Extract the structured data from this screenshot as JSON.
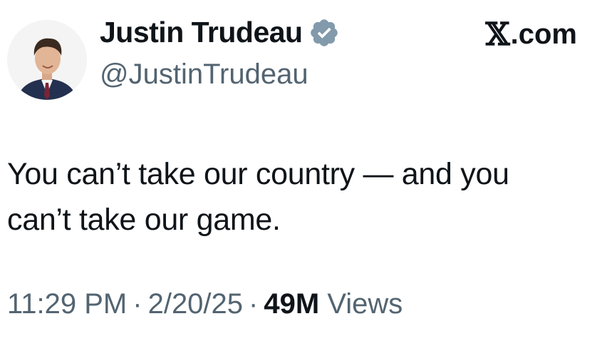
{
  "author": {
    "display_name": "Justin Trudeau",
    "handle": "@JustinTrudeau",
    "verified_icon": "verified-badge-icon",
    "avatar_icon": "profile-photo"
  },
  "brand": {
    "label": ".com",
    "logo_glyph": "𝕏"
  },
  "tweet": {
    "text": "You can’t take our country — and you\ncan’t take our game."
  },
  "meta": {
    "time": "11:29 PM",
    "separator": "·",
    "date": "2/20/25",
    "views_count": "49M",
    "views_label": "Views"
  },
  "colors": {
    "text_primary": "#0f1419",
    "text_secondary": "#536471",
    "verified_badge": "#829aab"
  }
}
